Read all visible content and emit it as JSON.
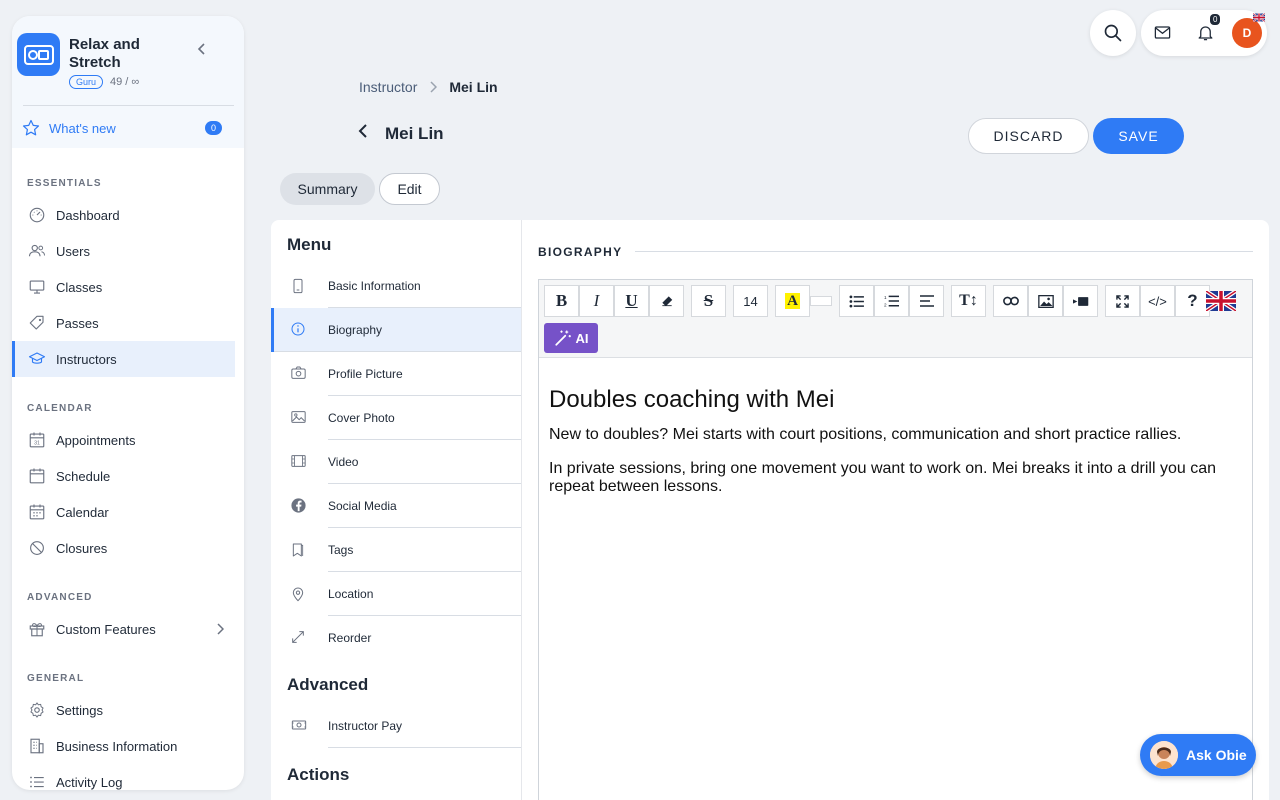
{
  "brand": {
    "name": "Relax and Stretch",
    "plan_badge": "Guru",
    "usage": "49 / ∞"
  },
  "whats_new": {
    "label": "What's new",
    "count": "0"
  },
  "sidebar": {
    "sections": [
      {
        "title": "ESSENTIALS",
        "items": [
          {
            "label": "Dashboard",
            "icon": "dashboard-icon"
          },
          {
            "label": "Users",
            "icon": "users-icon"
          },
          {
            "label": "Classes",
            "icon": "classes-icon"
          },
          {
            "label": "Passes",
            "icon": "tag-icon"
          },
          {
            "label": "Instructors",
            "icon": "graduation-cap-icon",
            "active": true
          }
        ]
      },
      {
        "title": "CALENDAR",
        "items": [
          {
            "label": "Appointments",
            "icon": "calendar-31-icon"
          },
          {
            "label": "Schedule",
            "icon": "calendar-icon"
          },
          {
            "label": "Calendar",
            "icon": "calendar-grid-icon"
          },
          {
            "label": "Closures",
            "icon": "ban-icon"
          }
        ]
      },
      {
        "title": "ADVANCED",
        "items": [
          {
            "label": "Custom Features",
            "icon": "gift-icon",
            "chevron": true
          }
        ]
      },
      {
        "title": "GENERAL",
        "items": [
          {
            "label": "Settings",
            "icon": "gear-icon"
          },
          {
            "label": "Business Information",
            "icon": "building-icon"
          },
          {
            "label": "Activity Log",
            "icon": "list-icon"
          }
        ]
      }
    ]
  },
  "topbar": {
    "notification_count": "0",
    "avatar_initial": "D"
  },
  "breadcrumb": {
    "parent": "Instructor",
    "current": "Mei Lin"
  },
  "page": {
    "title": "Mei Lin"
  },
  "actions": {
    "discard": "DISCARD",
    "save": "SAVE"
  },
  "tabs": {
    "summary": "Summary",
    "edit": "Edit"
  },
  "menu": {
    "title": "Menu",
    "items": [
      {
        "label": "Basic Information",
        "icon": "phone-icon"
      },
      {
        "label": "Biography",
        "icon": "info-icon",
        "active": true
      },
      {
        "label": "Profile Picture",
        "icon": "camera-icon"
      },
      {
        "label": "Cover Photo",
        "icon": "image-icon"
      },
      {
        "label": "Video",
        "icon": "film-icon"
      },
      {
        "label": "Social Media",
        "icon": "facebook-icon"
      },
      {
        "label": "Tags",
        "icon": "bookmark-icon"
      },
      {
        "label": "Location",
        "icon": "map-pin-icon"
      },
      {
        "label": "Reorder",
        "icon": "resize-arrows-icon"
      }
    ],
    "advanced_title": "Advanced",
    "advanced_items": [
      {
        "label": "Instructor Pay",
        "icon": "money-icon"
      }
    ],
    "actions_title": "Actions"
  },
  "biography": {
    "section_title": "BIOGRAPHY",
    "font_size": "14",
    "ai_label": "AI",
    "heading": "Doubles coaching with Mei",
    "paragraphs": [
      "New to doubles? Mei starts with court positions, communication and short practice rallies.",
      "In private sessions, bring one movement you want to work on. Mei breaks it into a drill you can repeat between lessons."
    ]
  },
  "assistant": {
    "label": "Ask Obie"
  },
  "colors": {
    "accent": "#2f7bf5",
    "ai": "#7652c8",
    "avatar": "#e8541e"
  }
}
